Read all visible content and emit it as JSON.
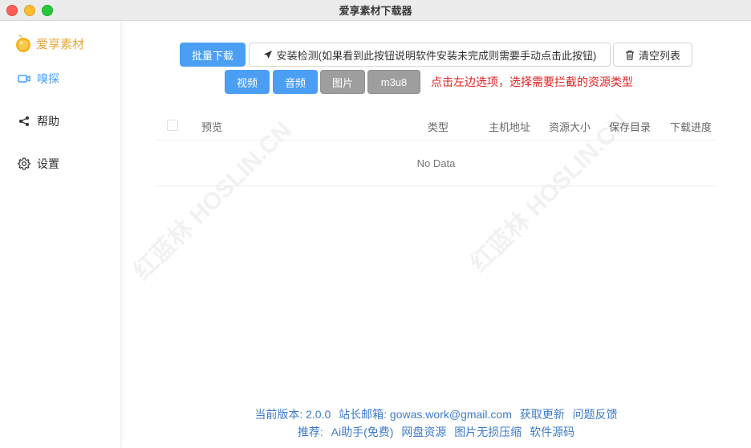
{
  "window": {
    "title": "爱享素材下载器"
  },
  "brand": {
    "name": "爱享素材"
  },
  "sidebar": {
    "items": [
      {
        "label": "嗅探",
        "icon": "video-camera-icon"
      },
      {
        "label": "帮助",
        "icon": "share-icon"
      },
      {
        "label": "设置",
        "icon": "gear-icon"
      }
    ]
  },
  "toolbar": {
    "batch_download": "批量下载",
    "install_check": "安装检测(如果看到此按钮说明软件安装未完成则需要手动点击此按钮)",
    "clear_list": "清空列表"
  },
  "filters": {
    "video": "视频",
    "audio": "音频",
    "image": "图片",
    "m3u8": "m3u8",
    "hint": "点击左边选项，选择需要拦截的资源类型"
  },
  "table": {
    "columns": [
      "预览",
      "类型",
      "主机地址",
      "资源大小",
      "保存目录",
      "下载进度"
    ],
    "empty_text": "No Data"
  },
  "footer": {
    "line1": [
      "当前版本: 2.0.0",
      "站长邮箱: gowas.work@gmail.com",
      "获取更新",
      "问题反馈"
    ],
    "line2": [
      "推荐:",
      "Ai助手(免费)",
      "网盘资源",
      "图片无损压缩",
      "软件源码"
    ]
  },
  "watermark": {
    "text": "红蓝林 HOSLIN.CN"
  },
  "colors": {
    "primary": "#4a9ff5",
    "active_nav": "#409eff",
    "hint_red": "#e02020",
    "brand_gold": "#e3a83a",
    "footer_link": "#3d7cc9",
    "filter_off": "#9e9e9e"
  }
}
